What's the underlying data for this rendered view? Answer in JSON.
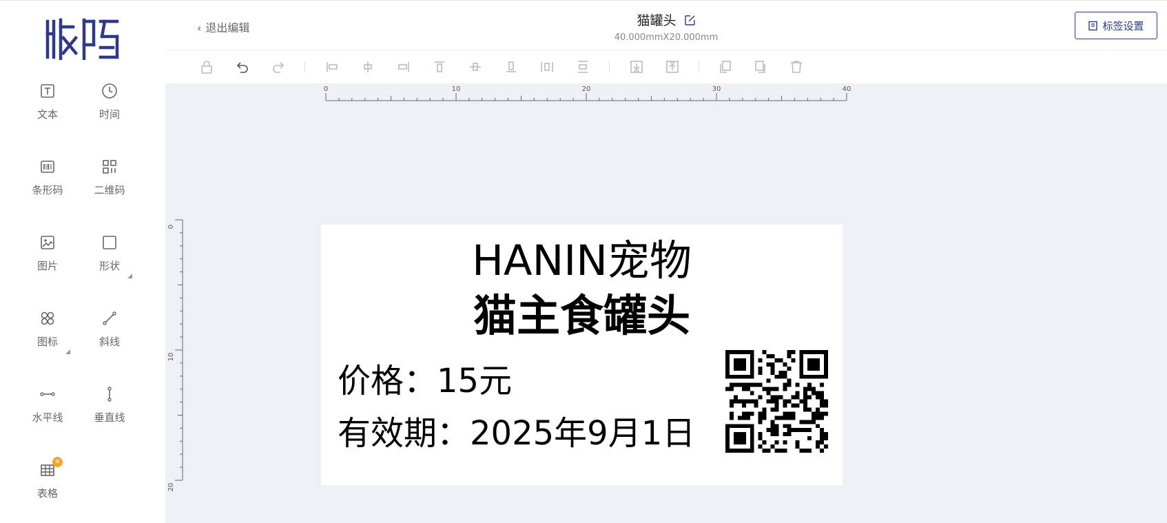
{
  "app": {
    "logo_text": "精臣"
  },
  "sidebar": {
    "items": [
      {
        "label": "文本",
        "icon": "text-icon"
      },
      {
        "label": "时间",
        "icon": "clock-icon"
      },
      {
        "label": "条形码",
        "icon": "barcode-icon"
      },
      {
        "label": "二维码",
        "icon": "qrcode-icon"
      },
      {
        "label": "图片",
        "icon": "image-icon"
      },
      {
        "label": "形状",
        "icon": "shape-icon"
      },
      {
        "label": "图标",
        "icon": "icons-icon"
      },
      {
        "label": "斜线",
        "icon": "diagonal-line-icon"
      },
      {
        "label": "水平线",
        "icon": "horizontal-line-icon"
      },
      {
        "label": "垂直线",
        "icon": "vertical-line-icon"
      },
      {
        "label": "表格",
        "icon": "table-icon"
      }
    ]
  },
  "header": {
    "back_label": "退出编辑",
    "title": "猫罐头",
    "size": "40.000mmX20.000mm",
    "settings_label": "标签设置"
  },
  "toolbar": {
    "tools": [
      "lock-icon",
      "undo-icon",
      "redo-icon",
      "align-left-icon",
      "align-center-h-icon",
      "align-right-icon",
      "align-top-icon",
      "align-middle-v-icon",
      "align-bottom-icon",
      "distribute-h-icon",
      "distribute-v-icon",
      "move-down-icon",
      "move-up-icon",
      "copy-icon",
      "paste-icon",
      "delete-icon"
    ]
  },
  "ruler": {
    "h_labels": [
      "0",
      "10",
      "20",
      "30",
      "40"
    ],
    "v_labels": [
      "0",
      "10",
      "20"
    ]
  },
  "label": {
    "line1": "HANIN宠物",
    "line2": "猫主食罐头",
    "price": "价格：15元",
    "expiry": "有效期：2025年9月1日"
  },
  "colors": {
    "brand": "#2e3a87",
    "canvas_bg": "#edf1f5",
    "badge": "#f5a623"
  }
}
